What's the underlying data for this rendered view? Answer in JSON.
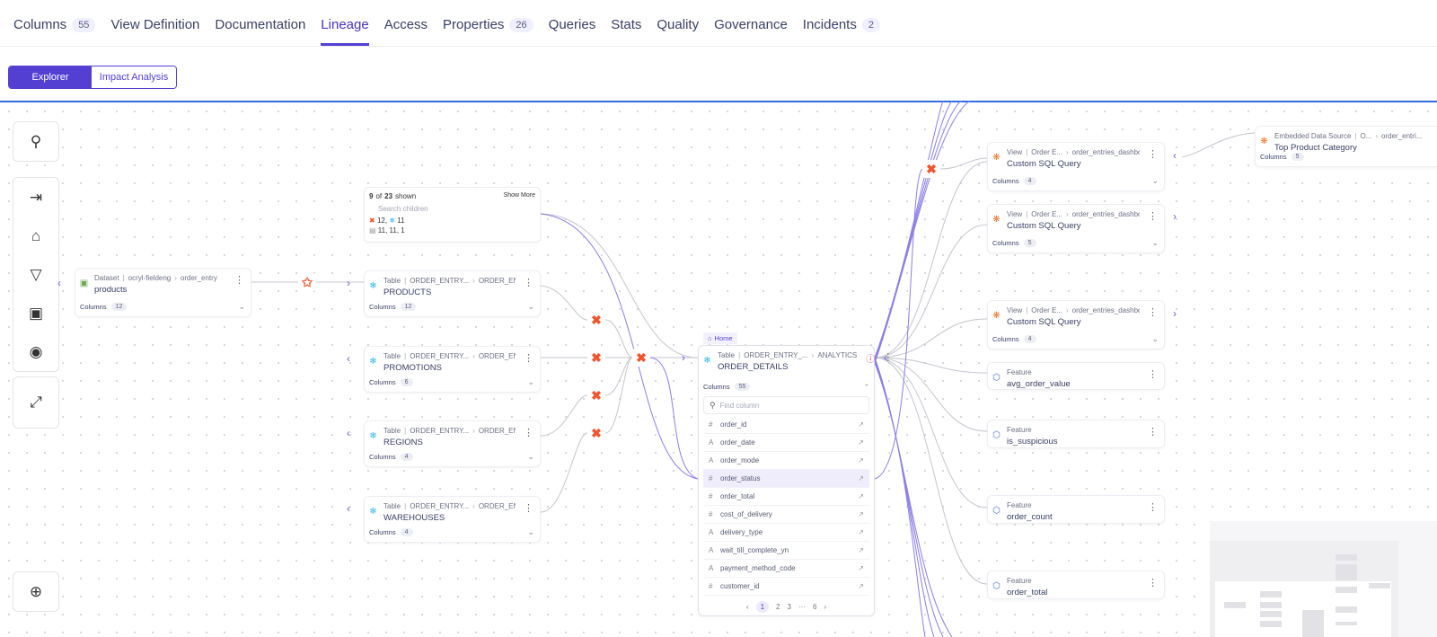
{
  "tabs": [
    {
      "label": "Columns",
      "count": "55"
    },
    {
      "label": "View Definition"
    },
    {
      "label": "Documentation"
    },
    {
      "label": "Lineage",
      "active": true
    },
    {
      "label": "Access"
    },
    {
      "label": "Properties",
      "count": "26"
    },
    {
      "label": "Queries"
    },
    {
      "label": "Stats"
    },
    {
      "label": "Quality"
    },
    {
      "label": "Governance"
    },
    {
      "label": "Incidents",
      "count": "2"
    }
  ],
  "mode": {
    "explorer": "Explorer",
    "impact": "Impact Analysis",
    "selected": "Explorer"
  },
  "toolbar": [
    "search-icon",
    "collapse-right-icon",
    "home-icon",
    "filter-icon",
    "calendar-icon",
    "camera-icon",
    "expand-icon",
    "zoom-in-icon"
  ],
  "children_panel": {
    "shown": "9",
    "total": "23",
    "shown_suffix": "shown",
    "of": "of",
    "show_more": "Show More",
    "search_placeholder": "Search children",
    "counts_line1": "12, ",
    "counts_line1b": "11",
    "counts_line2": "11,  11,  1"
  },
  "nodes": [
    {
      "type": "Dataset",
      "path1": "ocryl-fieldeng",
      "path2": "order_entry",
      "name": "products",
      "columns_label": "Columns",
      "columns": "12",
      "icon": "dataset-icon",
      "color": "#6aa84f"
    },
    {
      "type": "Table",
      "path1": "ORDER_ENTRY...",
      "path2": "ORDER_ENTRY",
      "name": "PRODUCTS",
      "columns_label": "Columns",
      "columns": "12",
      "icon": "snowflake-icon",
      "color": "#29b5e8"
    },
    {
      "type": "Table",
      "path1": "ORDER_ENTRY...",
      "path2": "ORDER_ENTRY",
      "name": "PROMOTIONS",
      "columns_label": "Columns",
      "columns": "6",
      "icon": "snowflake-icon",
      "color": "#29b5e8"
    },
    {
      "type": "Table",
      "path1": "ORDER_ENTRY...",
      "path2": "ORDER_ENTRY",
      "name": "REGIONS",
      "columns_label": "Columns",
      "columns": "4",
      "icon": "snowflake-icon",
      "color": "#29b5e8"
    },
    {
      "type": "Table",
      "path1": "ORDER_ENTRY...",
      "path2": "ORDER_ENTRY",
      "name": "WAREHOUSES",
      "columns_label": "Columns",
      "columns": "4",
      "icon": "snowflake-icon",
      "color": "#29b5e8"
    },
    {
      "type": "View",
      "path1": "Order E...",
      "path2": "order_entries_dashboard",
      "name": "Custom SQL Query",
      "columns_label": "Columns",
      "columns": "4",
      "icon": "tableau-icon",
      "color": "#e8762d"
    },
    {
      "type": "View",
      "path1": "Order E...",
      "path2": "order_entries_dashboard",
      "name": "Custom SQL Query",
      "columns_label": "Columns",
      "columns": "5",
      "icon": "tableau-icon",
      "color": "#e8762d"
    },
    {
      "type": "View",
      "path1": "Order E...",
      "path2": "order_entries_dashboard",
      "name": "Custom SQL Query",
      "columns_label": "Columns",
      "columns": "4",
      "icon": "tableau-icon",
      "color": "#e8762d"
    },
    {
      "type": "Embedded Data Source",
      "path1": "O...",
      "path2": "order_entri...",
      "name": "Top Product Category",
      "columns_label": "Columns",
      "columns": "5",
      "icon": "tableau-icon",
      "color": "#e8762d"
    },
    {
      "type": "Feature",
      "name": "avg_order_value",
      "icon": "feature-icon",
      "color": "#3a6fd8"
    },
    {
      "type": "Feature",
      "name": "is_suspicious",
      "icon": "feature-icon",
      "color": "#3a6fd8"
    },
    {
      "type": "Feature",
      "name": "order_count",
      "icon": "feature-icon",
      "color": "#3a6fd8"
    },
    {
      "type": "Feature",
      "name": "order_total",
      "icon": "feature-icon",
      "color": "#3a6fd8"
    }
  ],
  "focus": {
    "home_label": "Home",
    "type": "Table",
    "path1": "ORDER_ENTRY_...",
    "path2": "ANALYTICS",
    "name": "ORDER_DETAILS",
    "columns_label": "Columns",
    "columns": "55",
    "find_placeholder": "Find column",
    "column_list": [
      {
        "name": "order_id",
        "kind": "number"
      },
      {
        "name": "order_date",
        "kind": "string"
      },
      {
        "name": "order_mode",
        "kind": "string"
      },
      {
        "name": "order_status",
        "kind": "number",
        "selected": true
      },
      {
        "name": "order_total",
        "kind": "number"
      },
      {
        "name": "cost_of_delivery",
        "kind": "number"
      },
      {
        "name": "delivery_type",
        "kind": "string"
      },
      {
        "name": "wait_till_complete_yn",
        "kind": "string"
      },
      {
        "name": "payment_method_code",
        "kind": "string"
      },
      {
        "name": "customer_id",
        "kind": "number"
      }
    ],
    "pages": [
      "1",
      "2",
      "3",
      "···",
      "6"
    ],
    "current_page": "1"
  },
  "colors": {
    "accent": "#533fd1",
    "edge": "#8b7ee6",
    "edge_muted": "#c4c6cf",
    "fine_grained": "#f2542d",
    "warning": "#e04848"
  }
}
